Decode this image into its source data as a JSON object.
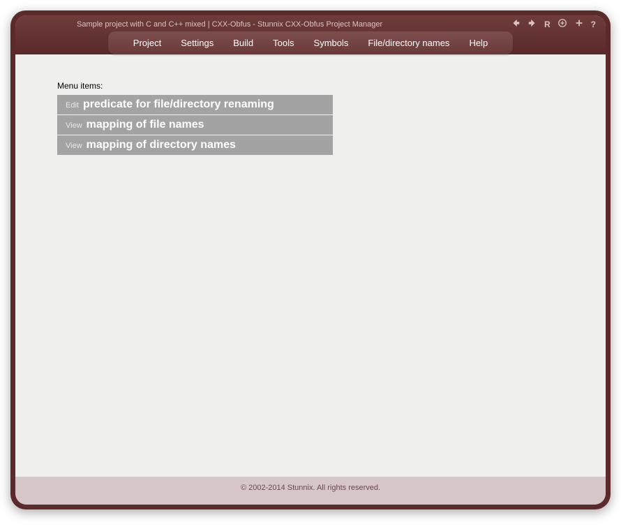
{
  "header": {
    "title": "Sample project with C and C++ mixed | CXX-Obfus - Stunnix CXX-Obfus Project Manager"
  },
  "toolbar": {
    "refresh": "R",
    "help": "?"
  },
  "menubar": {
    "items": [
      "Project",
      "Settings",
      "Build",
      "Tools",
      "Symbols",
      "File/directory names",
      "Help"
    ]
  },
  "content": {
    "section_label": "Menu items:",
    "items": [
      {
        "prefix": "Edit",
        "label": "predicate for file/directory renaming"
      },
      {
        "prefix": "View",
        "label": "mapping of file names"
      },
      {
        "prefix": "View",
        "label": "mapping of directory names"
      }
    ]
  },
  "footer": {
    "copyright": "© 2002-2014 Stunnix. All rights reserved."
  }
}
